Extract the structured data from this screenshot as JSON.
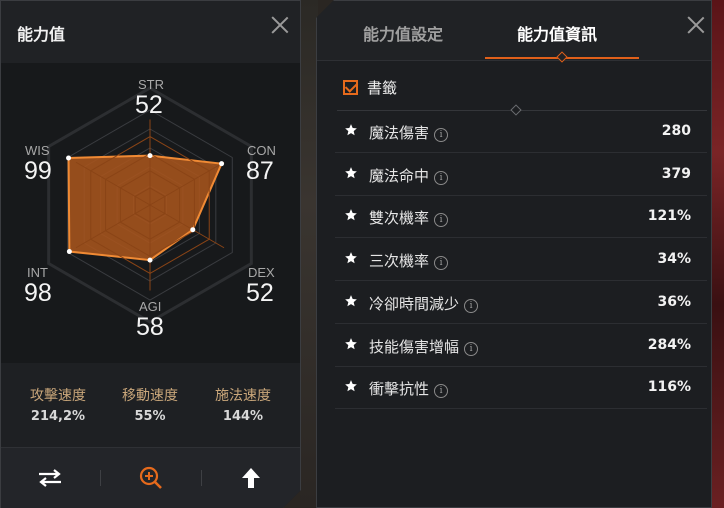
{
  "left_panel": {
    "title": "能力值",
    "stats": {
      "str": {
        "label": "STR",
        "value": 52
      },
      "con": {
        "label": "CON",
        "value": 87
      },
      "dex": {
        "label": "DEX",
        "value": 52
      },
      "agi": {
        "label": "AGI",
        "value": 58
      },
      "int": {
        "label": "INT",
        "value": 98
      },
      "wis": {
        "label": "WIS",
        "value": 99
      }
    },
    "speeds": [
      {
        "label": "攻擊速度",
        "value": "214,2%"
      },
      {
        "label": "移動速度",
        "value": "55%"
      },
      {
        "label": "施法速度",
        "value": "144%"
      }
    ],
    "footer_icons": [
      "swap-icon",
      "zoom-in-icon",
      "upgrade-arrow-icon"
    ]
  },
  "right_panel": {
    "tabs": [
      {
        "label": "能力值設定",
        "active": false
      },
      {
        "label": "能力值資訊",
        "active": true
      }
    ],
    "bookmark": {
      "label": "書籤",
      "checked": true
    },
    "rows": [
      {
        "name": "魔法傷害",
        "value": "280"
      },
      {
        "name": "魔法命中",
        "value": "379"
      },
      {
        "name": "雙次機率",
        "value": "121%"
      },
      {
        "name": "三次機率",
        "value": "34%"
      },
      {
        "name": "冷卻時間減少",
        "value": "36%"
      },
      {
        "name": "技能傷害增幅",
        "value": "284%"
      },
      {
        "name": "衝擊抗性",
        "value": "116%"
      }
    ]
  },
  "colors": {
    "accent": "#e66a1c",
    "radar_fill": "#a7541c",
    "speed_label": "#c9a67a"
  }
}
